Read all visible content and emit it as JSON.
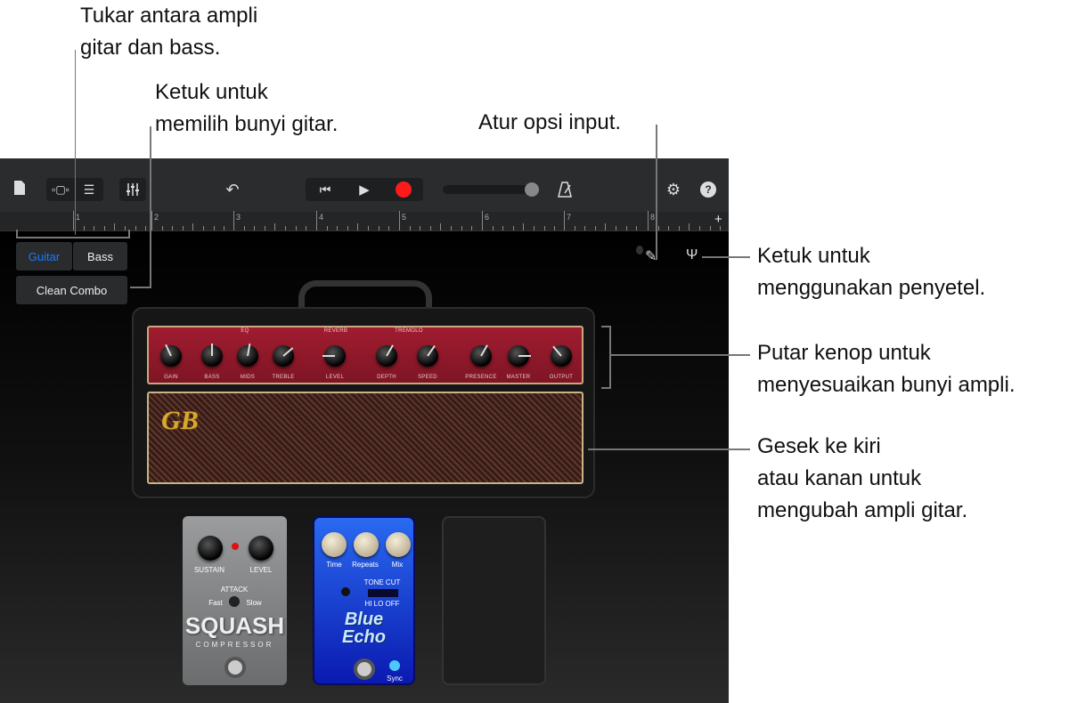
{
  "callouts": {
    "switch_amp": [
      "Tukar antara ampli",
      "gitar dan bass."
    ],
    "choose_sound": [
      "Ketuk untuk",
      "memilih bunyi gitar."
    ],
    "input_options": "Atur opsi input.",
    "tuner": [
      "Ketuk untuk",
      "menggunakan penyetel."
    ],
    "knobs": [
      "Putar kenop untuk",
      "menyesuaikan bunyi ampli."
    ],
    "swipe": [
      "Gesek ke kiri",
      "atau kanan untuk",
      "mengubah ampli gitar."
    ]
  },
  "toolbar": {
    "icons": [
      "document-icon",
      "view-toggle-icon",
      "tracks-icon",
      "mixer-icon",
      "undo-icon",
      "go-to-start-icon",
      "play-icon",
      "record-icon",
      "volume-slider",
      "metronome-icon",
      "settings-icon",
      "help-icon"
    ],
    "record_color": "#ff1a1a",
    "volume": 0.95
  },
  "ruler": {
    "bars": [
      "1",
      "2",
      "3",
      "4",
      "5",
      "6",
      "7",
      "8"
    ],
    "add": "+"
  },
  "selector": {
    "guitar": "Guitar",
    "bass": "Bass",
    "preset": "Clean Combo",
    "active_color": "#1a7cf5"
  },
  "amp": {
    "sections": [
      "EQ",
      "REVERB",
      "TREMOLO"
    ],
    "knobs": [
      "GAIN",
      "BASS",
      "MIDS",
      "TREBLE",
      "LEVEL",
      "DEPTH",
      "SPEED",
      "PRESENCE",
      "MASTER",
      "OUTPUT"
    ],
    "logo": "GB",
    "panel_color": "#8e1a2a"
  },
  "pedals": {
    "squash": {
      "knobs": [
        "SUSTAIN",
        "LEVEL"
      ],
      "attack": "ATTACK",
      "fast": "Fast",
      "slow": "Slow",
      "name": "SQUASH",
      "subtitle": "COMPRESSOR"
    },
    "echo": {
      "knobs": [
        "Time",
        "Repeats",
        "Mix"
      ],
      "tone_cut": "TONE CUT",
      "switch": "HI LO OFF",
      "name1": "Blue",
      "name2": "Echo",
      "sync": "Sync"
    }
  }
}
